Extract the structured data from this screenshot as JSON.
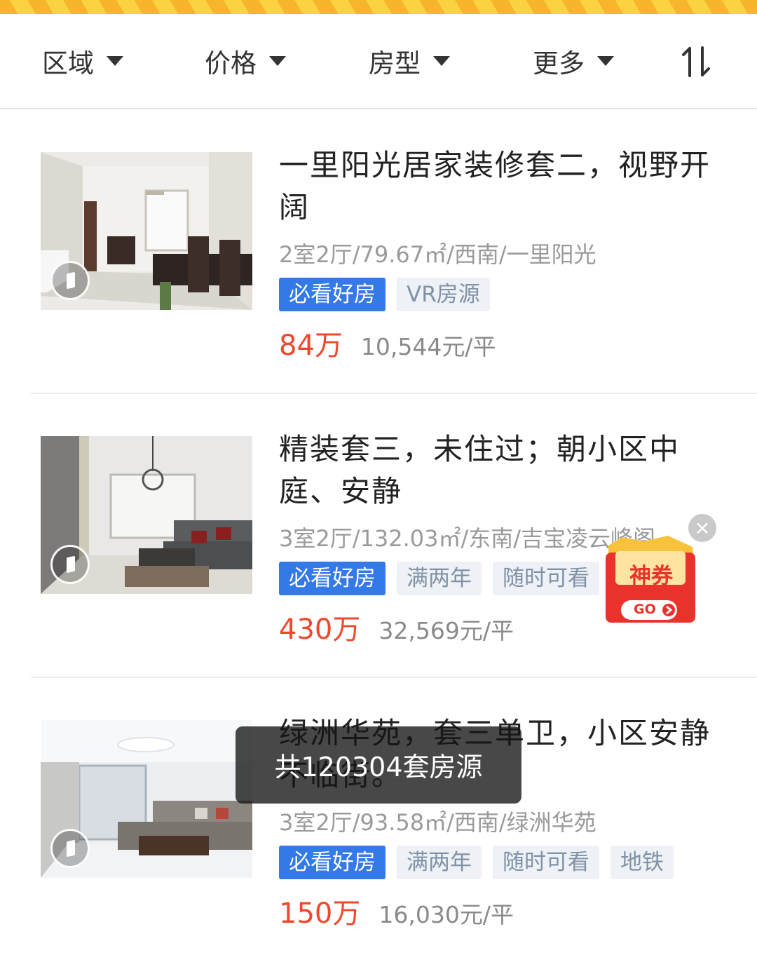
{
  "filters": [
    {
      "label": "区域"
    },
    {
      "label": "价格"
    },
    {
      "label": "房型"
    },
    {
      "label": "更多"
    }
  ],
  "listings": [
    {
      "title": "一里阳光居家装修套二，视野开阔",
      "meta": "2室2厅/79.67㎡/西南/一里阳光",
      "tags": [
        "必看好房",
        "VR房源"
      ],
      "price": "84万",
      "unit_price": "10,544元/平"
    },
    {
      "title": "精装套三，未住过；朝小区中庭、安静",
      "meta": "3室2厅/132.03㎡/东南/吉宝凌云峰阁",
      "tags": [
        "必看好房",
        "满两年",
        "随时可看"
      ],
      "price": "430万",
      "unit_price": "32,569元/平"
    },
    {
      "title": "绿洲华苑，套三单卫，小区安静不临街。",
      "meta": "3室2厅/93.58㎡/西南/绿洲华苑",
      "tags": [
        "必看好房",
        "满两年",
        "随时可看",
        "地铁"
      ],
      "price": "150万",
      "unit_price": "16,030元/平"
    }
  ],
  "coupon": {
    "label": "神券",
    "go": "GO"
  },
  "toast": {
    "text": "共120304套房源"
  }
}
